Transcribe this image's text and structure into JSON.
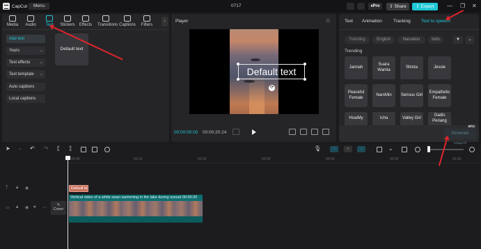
{
  "app": {
    "name": "CapCut",
    "menu_label": "Menu",
    "doc_title": "0717"
  },
  "titlebar": {
    "pro_label": "Pro",
    "share_label": "Share",
    "export_label": "Export"
  },
  "media_tabs": [
    {
      "label": "Media",
      "icon": "media-icon"
    },
    {
      "label": "Audio",
      "icon": "audio-icon"
    },
    {
      "label": "Text",
      "icon": "text-icon",
      "active": true
    },
    {
      "label": "Stickers",
      "icon": "stickers-icon"
    },
    {
      "label": "Effects",
      "icon": "effects-icon"
    },
    {
      "label": "Transitions",
      "icon": "transitions-icon"
    },
    {
      "label": "Captions",
      "icon": "captions-icon"
    },
    {
      "label": "Filters",
      "icon": "filters-icon"
    }
  ],
  "text_sidebar": [
    "Add text",
    "Yours",
    "Text effects",
    "Text template",
    "Auto captions",
    "Local captions"
  ],
  "text_card": "Default text",
  "player": {
    "title": "Player",
    "overlay_text": "Default text",
    "current_time": "00:00:00:00",
    "duration": "00:00:20:24"
  },
  "right_tabs": [
    "Text",
    "Animation",
    "Tracking",
    "Text to speech"
  ],
  "tts_filters": [
    "Trending",
    "English",
    "Narration",
    "Indo"
  ],
  "tts_section": "Trending",
  "voices": [
    [
      "Jannah",
      "Suara Wanita",
      "Shinta",
      "Jessie"
    ],
    [
      "Peaceful Female",
      "NamMin",
      "Serious Girl",
      "Empathetic Female"
    ],
    [
      "HoaiMy",
      "Icha",
      "Valley Girl",
      "Gadis Periang"
    ]
  ],
  "generate_label": "Generate speech",
  "timeline": {
    "ticks": [
      "00:00",
      "00:10",
      "00:20",
      "00:30",
      "00:40",
      "00:50",
      "01:00"
    ],
    "text_clip_label": "Default te",
    "video_clip_label": "Vertical video of a white swan swimming in the lake during sunset",
    "video_clip_duration": "00:00:20",
    "cover_label": "Cover"
  },
  "colors": {
    "accent": "#1ec8d6",
    "annotation_arrow": "#e0242c"
  }
}
